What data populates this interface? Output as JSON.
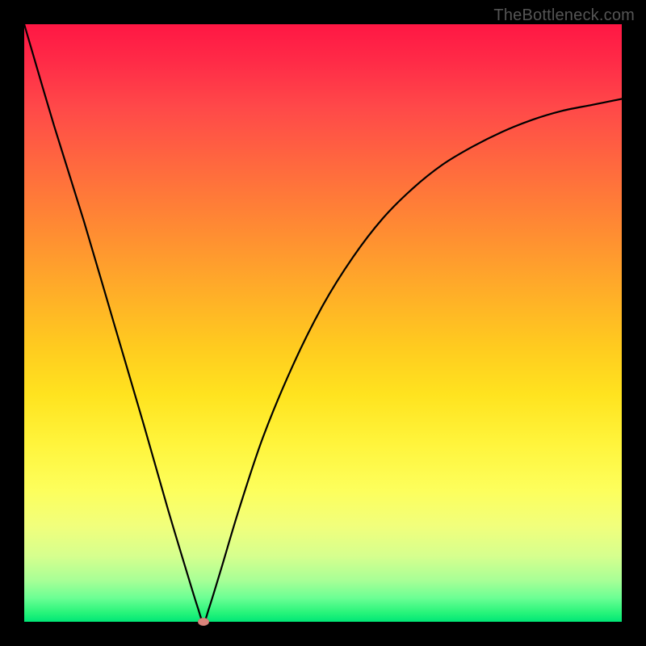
{
  "watermark": "TheBottleneck.com",
  "colors": {
    "gradient_top": "#ff1744",
    "gradient_bottom": "#00e676",
    "frame": "#000000",
    "curve": "#000000",
    "marker": "#d9837a",
    "watermark_text": "#555555"
  },
  "chart_data": {
    "type": "line",
    "title": "",
    "xlabel": "",
    "ylabel": "",
    "xlim": [
      0,
      100
    ],
    "ylim": [
      0,
      100
    ],
    "grid": false,
    "legend": false,
    "annotations": [
      {
        "text": "TheBottleneck.com",
        "position": "top-right"
      }
    ],
    "series": [
      {
        "name": "bottleneck-curve",
        "x": [
          0,
          5,
          10,
          15,
          20,
          24,
          27,
          29,
          30,
          31,
          33,
          36,
          40,
          45,
          50,
          55,
          60,
          65,
          70,
          75,
          80,
          85,
          90,
          95,
          100
        ],
        "values": [
          100,
          83,
          67,
          50,
          33,
          19,
          9,
          2.5,
          0,
          2.5,
          9,
          19,
          31,
          43,
          53,
          61,
          67.5,
          72.5,
          76.5,
          79.5,
          82,
          84,
          85.5,
          86.5,
          87.5
        ]
      }
    ],
    "marker": {
      "x": 30,
      "y": 0
    }
  }
}
